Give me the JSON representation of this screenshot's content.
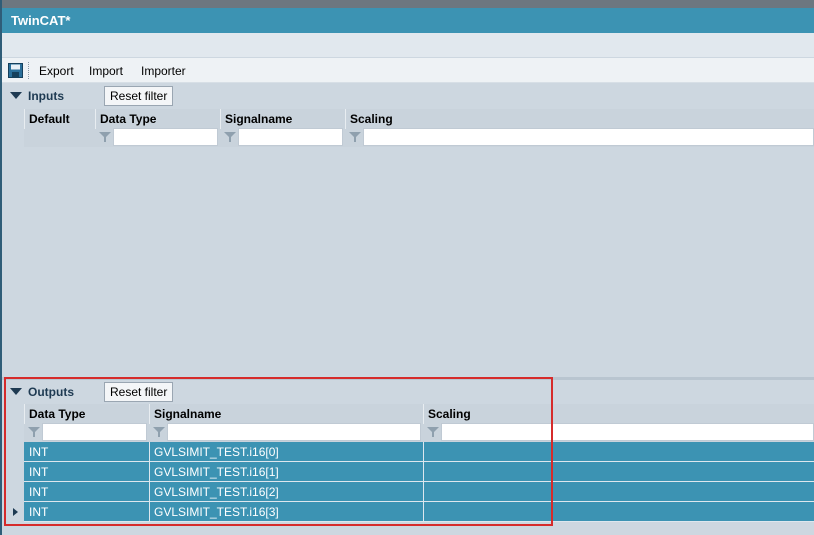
{
  "window": {
    "title": "TwinCAT*"
  },
  "toolbar": {
    "save_icon": "save-icon",
    "items": [
      "Export",
      "Import",
      "Importer"
    ]
  },
  "inputs": {
    "label": "Inputs",
    "reset_label": "Reset filter",
    "columns": [
      "Default",
      "Data Type",
      "Signalname",
      "Scaling"
    ]
  },
  "outputs": {
    "label": "Outputs",
    "reset_label": "Reset filter",
    "columns": [
      "Data Type",
      "Signalname",
      "Scaling"
    ],
    "rows": [
      {
        "data_type": "INT",
        "signalname": "GVLSIMIT_TEST.i16[0]",
        "scaling": ""
      },
      {
        "data_type": "INT",
        "signalname": "GVLSIMIT_TEST.i16[1]",
        "scaling": ""
      },
      {
        "data_type": "INT",
        "signalname": "GVLSIMIT_TEST.i16[2]",
        "scaling": ""
      },
      {
        "data_type": "INT",
        "signalname": "GVLSIMIT_TEST.i16[3]",
        "scaling": ""
      }
    ]
  },
  "colors": {
    "title_bar": "#3c93b3",
    "selected_row": "#3c93b3",
    "highlight_border": "#d62b2b"
  }
}
